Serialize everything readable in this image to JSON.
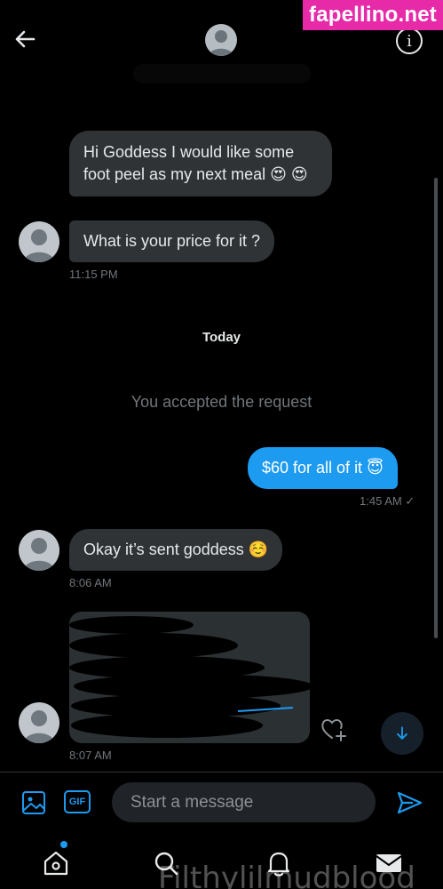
{
  "watermark": {
    "site": "fapellino.net",
    "username": "Filthylilmudblood"
  },
  "header": {
    "back_icon": "arrow-left-icon",
    "avatar_icon": "default-avatar-icon",
    "info_label": "i",
    "info_icon": "info-circle-icon"
  },
  "messages": [
    {
      "direction": "incoming",
      "text": "Hi Goddess I would like some foot peel as my next meal 😍 😍"
    },
    {
      "direction": "incoming",
      "text": "What is your price for it ?",
      "time": "11:15 PM"
    },
    {
      "direction": "outgoing",
      "text": "$60 for all of it 😇",
      "time": "1:45 AM",
      "status_icon": "check-icon"
    },
    {
      "direction": "incoming",
      "text": "Okay it’s sent goddess ☺️",
      "time": "8:06 AM"
    },
    {
      "direction": "incoming",
      "type": "media",
      "time": "8:07 AM"
    }
  ],
  "day_divider": "Today",
  "system_message": "You accepted the request",
  "actions": {
    "heart_add_icon": "heart-plus-icon",
    "scroll_down_icon": "arrow-down-icon"
  },
  "composer": {
    "image_icon": "image-icon",
    "gif_label": "GIF",
    "placeholder": "Start a message",
    "send_icon": "send-icon"
  },
  "tabbar": {
    "items": [
      {
        "name": "home",
        "icon": "home-icon",
        "has_badge": true
      },
      {
        "name": "search",
        "icon": "search-icon"
      },
      {
        "name": "notifications",
        "icon": "bell-icon"
      },
      {
        "name": "messages",
        "icon": "mail-icon"
      }
    ]
  },
  "colors": {
    "accent": "#1d9bf0",
    "incoming_bubble": "#2f3336",
    "background": "#000000",
    "watermark_bg": "#e62aa8"
  }
}
